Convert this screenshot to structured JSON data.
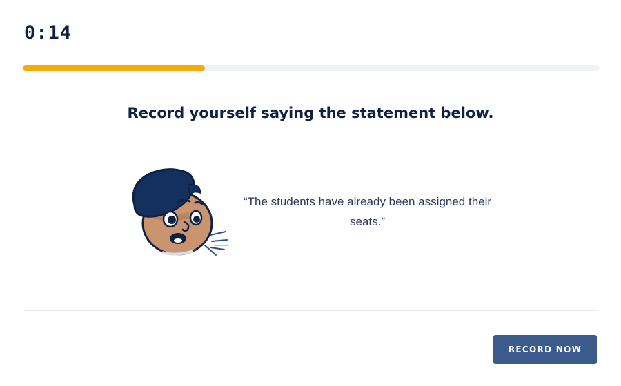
{
  "timer": {
    "text": "0:14"
  },
  "progress": {
    "fraction": 0.316,
    "fill_color": "#f5ab0a",
    "track_color": "#eff2f5"
  },
  "prompt": {
    "instruction": "Record yourself saying the statement below.",
    "statement": "“The students have already been assigned their seats.”"
  },
  "speaker": {
    "icon": "speaking-person-icon"
  },
  "actions": {
    "record_label": "RECORD NOW",
    "record_color": "#3a5b8c"
  }
}
